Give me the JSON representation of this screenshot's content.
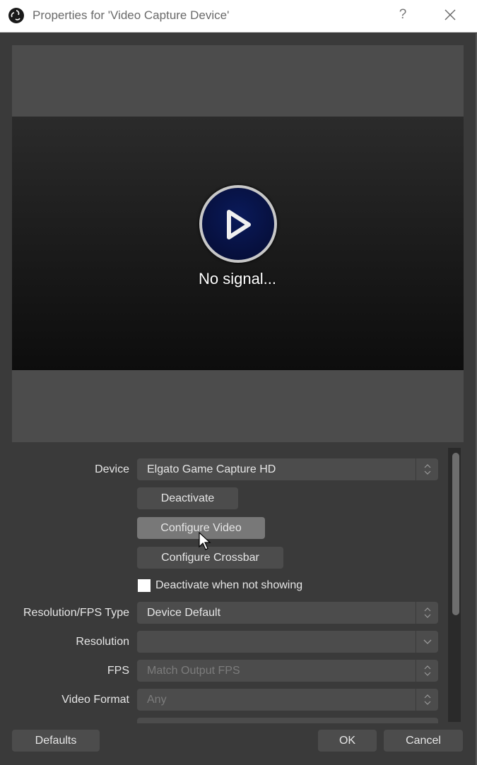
{
  "window": {
    "title": "Properties for 'Video Capture Device'",
    "help_label": "?",
    "close_icon": "close-icon",
    "app_icon": "obs-logo-icon"
  },
  "preview": {
    "status_text": "No signal...",
    "icon": "play-icon"
  },
  "properties": {
    "device": {
      "label": "Device",
      "value": "Elgato Game Capture HD"
    },
    "deactivate_button": "Deactivate",
    "configure_video_button": "Configure Video",
    "configure_crossbar_button": "Configure Crossbar",
    "deactivate_when_not_showing": {
      "label": "Deactivate when not showing",
      "checked": false
    },
    "resolution_fps_type": {
      "label": "Resolution/FPS Type",
      "value": "Device Default"
    },
    "resolution": {
      "label": "Resolution",
      "value": ""
    },
    "fps": {
      "label": "FPS",
      "value": "Match Output FPS"
    },
    "video_format": {
      "label": "Video Format",
      "value": "Any"
    }
  },
  "footer": {
    "defaults_button": "Defaults",
    "ok_button": "OK",
    "cancel_button": "Cancel"
  }
}
